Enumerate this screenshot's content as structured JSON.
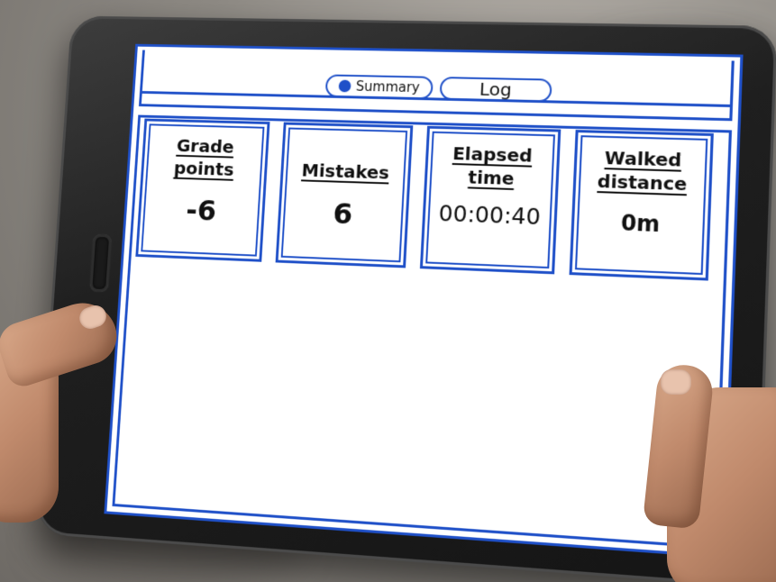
{
  "tabs": {
    "summary_label": "Summary",
    "log_label": "Log",
    "selected": "Summary"
  },
  "stats": [
    {
      "title": "Grade points",
      "value": "-6"
    },
    {
      "title": "Mistakes",
      "value": "6"
    },
    {
      "title": "Elapsed time",
      "value": "00:00:40"
    },
    {
      "title": "Walked distance",
      "value": "0m"
    }
  ],
  "colors": {
    "accent": "#1f50c8",
    "screen_background": "#ffffff",
    "tablet_bezel": "#1f1f1f"
  },
  "icons": {
    "summary_tab_indicator": "radio-selected-icon"
  }
}
